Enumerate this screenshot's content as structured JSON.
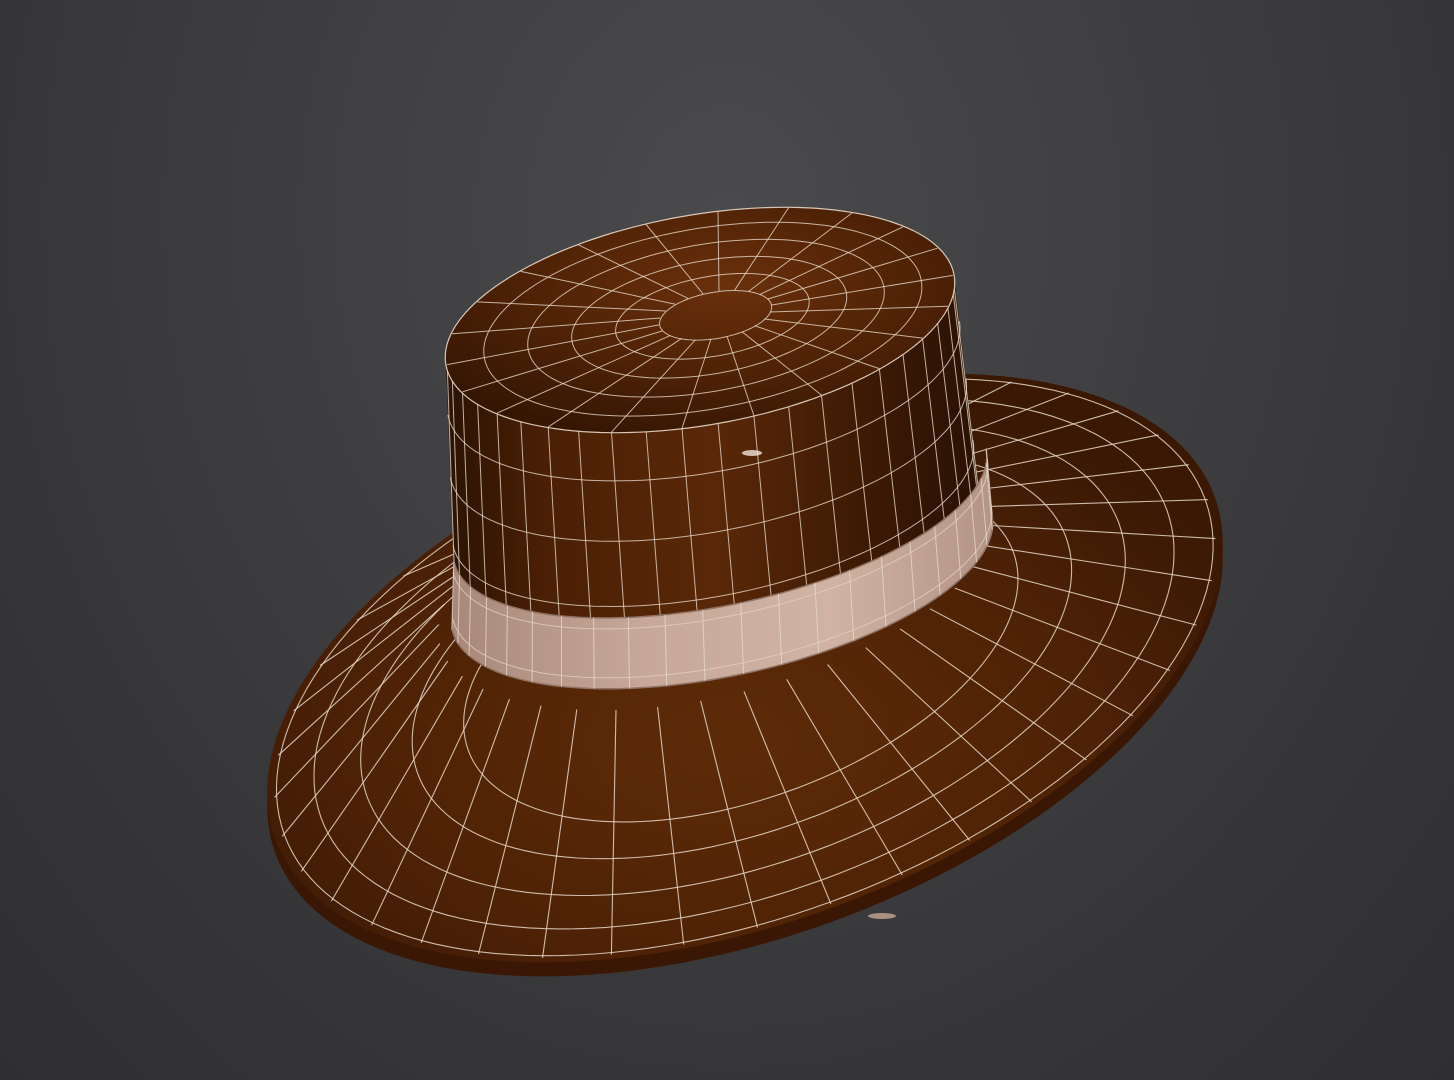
{
  "viewport": {
    "name": "3d-perspective-viewport",
    "background_color": "#3f3f41",
    "shading_mode": "shaded-with-wireframe-overlay"
  },
  "model": {
    "object": "hat",
    "material_colors": {
      "felt": "#5a2a08",
      "felt_dark": "#2a1204",
      "felt_highlight": "#7a3a12",
      "band": "#c9aa99",
      "band_dark": "#8f7264",
      "wireframe": "#e8d8c8"
    },
    "parts": [
      "crown",
      "band",
      "brim"
    ]
  }
}
